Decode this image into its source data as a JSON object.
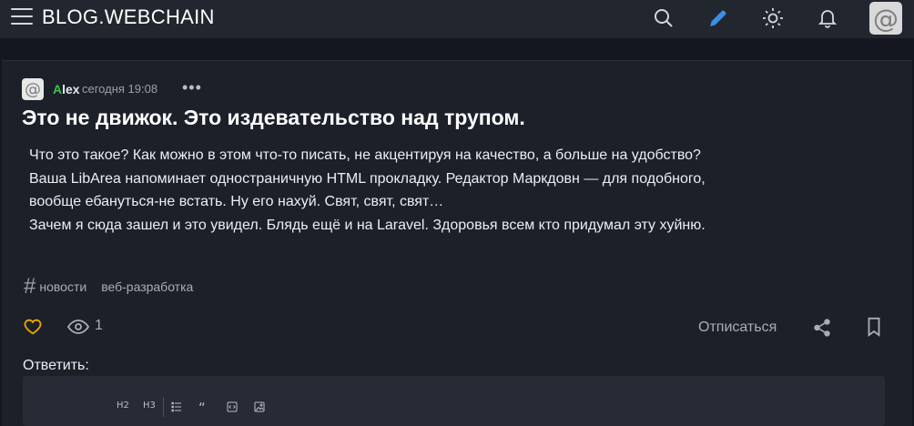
{
  "header": {
    "logo": "BLOG.WEBCHAIN",
    "avatar_glyph": "@",
    "icons": [
      "menu-icon",
      "search-icon",
      "pencil-icon",
      "sun-icon",
      "bell-icon"
    ],
    "accent": "#3a8ee6"
  },
  "post": {
    "author_first": "A",
    "author_rest": "lex",
    "author_first_color": "#3fbf4b",
    "avatar_glyph": "@",
    "date": "сегодня 19:08",
    "menu_glyph": "•••",
    "title": "Это не движок. Это издевательство над трупом.",
    "body": [
      "Что это такое? Как можно в этом что-то писать, не акцентируя на качество, а больше на удобство? Ваша LibArea напоминает одностраничную HTML прокладку. Редактор Маркдовн — для подобного, вообще ебануться-не встать. Ну его нахуй. Свят, свят, свят…",
      "Зачем я сюда зашел и это увидел. Блядь ещё и на Laravel. Здоровья всем кто придумал эту хуйню."
    ],
    "tag_glyph": "#",
    "tags": [
      "новости",
      "веб-разработка"
    ],
    "views": "1",
    "unsubscribe": "Отписаться",
    "like_color": "#e6a800"
  },
  "reply": {
    "label": "Ответить:",
    "toolbar": [
      "H2",
      "H3",
      "list-icon",
      "quote-icon",
      "code-icon",
      "image-icon"
    ]
  }
}
